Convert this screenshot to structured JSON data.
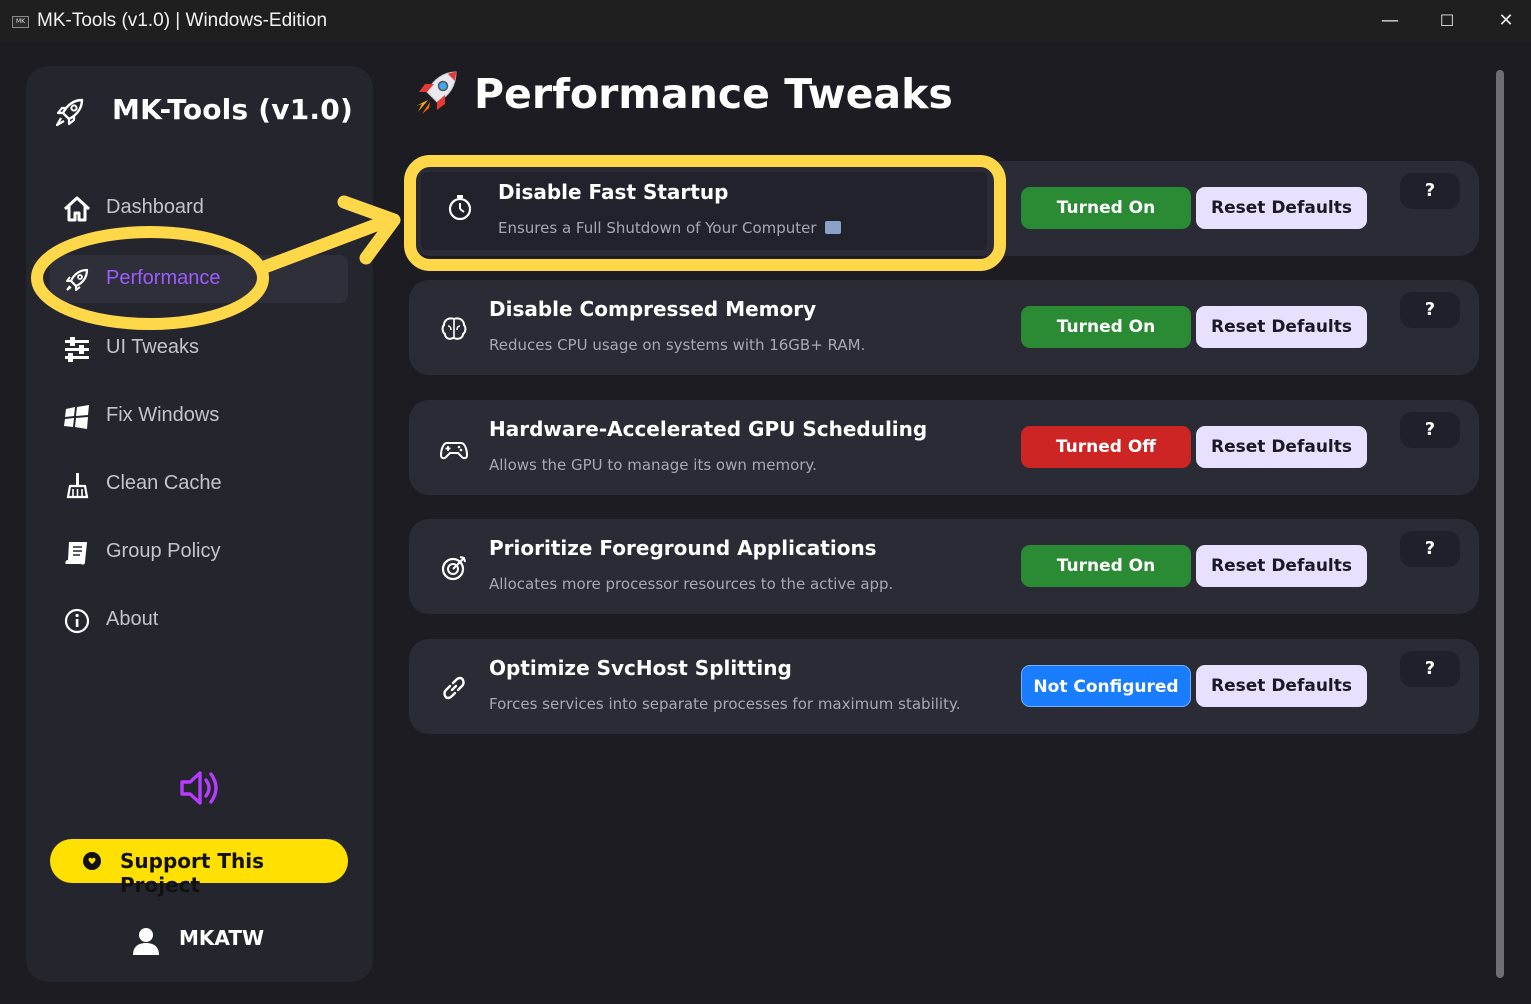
{
  "window": {
    "app_icon_text": "MK",
    "title": "MK-Tools (v1.0) | Windows-Edition",
    "minimize": "—",
    "maximize": "☐",
    "close": "✕"
  },
  "sidebar": {
    "brand": "MK-Tools (v1.0)",
    "items": [
      {
        "label": "Dashboard",
        "icon": "home-icon"
      },
      {
        "label": "Performance",
        "icon": "rocket-icon"
      },
      {
        "label": "UI Tweaks",
        "icon": "sliders-icon"
      },
      {
        "label": "Fix Windows",
        "icon": "windows-icon"
      },
      {
        "label": "Clean Cache",
        "icon": "broom-icon"
      },
      {
        "label": "Group Policy",
        "icon": "scroll-icon"
      },
      {
        "label": "About",
        "icon": "info-icon"
      }
    ],
    "active_item": "Performance",
    "support_label": "Support This Project",
    "user_name": "MKATW"
  },
  "main": {
    "title": "Performance Tweaks",
    "reset_label": "Reset Defaults",
    "help_label": "?",
    "tweaks": [
      {
        "title": "Disable Fast Startup",
        "desc": "Ensures a Full Shutdown of Your Computer",
        "state": "Turned On",
        "icon": "stopwatch-icon",
        "state_color": "#2b8a34"
      },
      {
        "title": "Disable Compressed Memory",
        "desc": "Reduces CPU usage on systems with 16GB+ RAM.",
        "state": "Turned On",
        "icon": "brain-icon",
        "state_color": "#2b8a34"
      },
      {
        "title": "Hardware-Accelerated GPU Scheduling",
        "desc": "Allows the GPU to manage its own memory.",
        "state": "Turned Off",
        "icon": "gamepad-icon",
        "state_color": "#cd2424"
      },
      {
        "title": "Prioritize Foreground Applications",
        "desc": "Allocates more processor resources to the active app.",
        "state": "Turned On",
        "icon": "target-icon",
        "state_color": "#2b8a34"
      },
      {
        "title": "Optimize SvcHost Splitting",
        "desc": "Forces services into separate processes for maximum stability.",
        "state": "Not Configured",
        "icon": "link-icon",
        "state_color": "#1a7cff"
      }
    ]
  },
  "colors": {
    "accent_purple": "#9d5cff",
    "annotation_yellow": "#ffd84a",
    "support_yellow": "#ffe000"
  }
}
